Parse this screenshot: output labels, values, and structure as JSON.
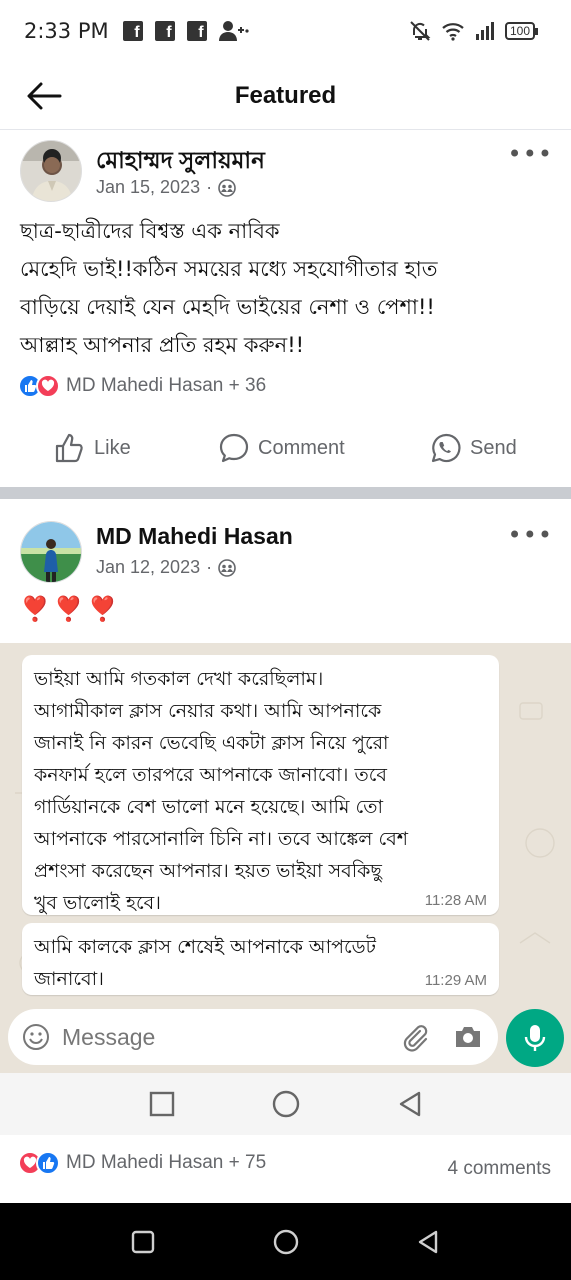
{
  "status_bar": {
    "time": "2:33 PM",
    "fb_letter": "f",
    "battery": "100"
  },
  "header": {
    "title": "Featured"
  },
  "post1": {
    "author": "মোহাম্মদ সুলায়মান",
    "date": "Jan 15, 2023",
    "separator": "·",
    "text": "ছাত্র-ছাত্রীদের বিশ্বস্ত এক নাবিক\nমেহেদি ভাই!!কঠিন সময়ের মধ্যে সহযোগীতার হাত\nবাড়িয়ে দেয়াই যেন মেহদি ভাইয়ের নেশা ও পেশা!!\nআল্লাহ আপনার প্রতি রহম করুন!!",
    "reactions": "MD Mahedi Hasan + 36",
    "actions": {
      "like": "Like",
      "comment": "Comment",
      "send": "Send"
    }
  },
  "post2": {
    "author": "MD Mahedi Hasan",
    "date": "Jan 12, 2023",
    "separator": "·",
    "emoji": "❣️❣️❣️",
    "messages": [
      {
        "text": "ভাইয়া আমি গতকাল দেখা করেছিলাম।\nআগামীকাল ক্লাস নেয়ার কথা। আমি আপনাকে\nজানাই নি কারন ভেবেছি একটা ক্লাস নিয়ে পুরো\nকনফার্ম হলে তারপরে আপনাকে জানাবো। তবে\nগার্ডিয়ানকে বেশ ভালো মনে হয়েছে। আমি তো\nআপনাকে পারসোনালি চিনি না। তবে আঙ্কেল বেশ\nপ্রশংসা করেছেন আপনার। হয়ত ভাইয়া সবকিছু\nখুব ভালোই হবে।",
        "time": "11:28 AM"
      },
      {
        "text": "আমি কালকে ক্লাস শেষেই আপনাকে আপডেট\nজানাবো।",
        "time": "11:29 AM"
      }
    ],
    "input_placeholder": "Message",
    "reactions": "MD Mahedi Hasan + 75",
    "comments": "4 comments"
  },
  "colors": {
    "fb_blue": "#1877f2",
    "love_red": "#f33e58",
    "wa_green": "#00a884",
    "wa_bg": "#e9e3d9"
  }
}
